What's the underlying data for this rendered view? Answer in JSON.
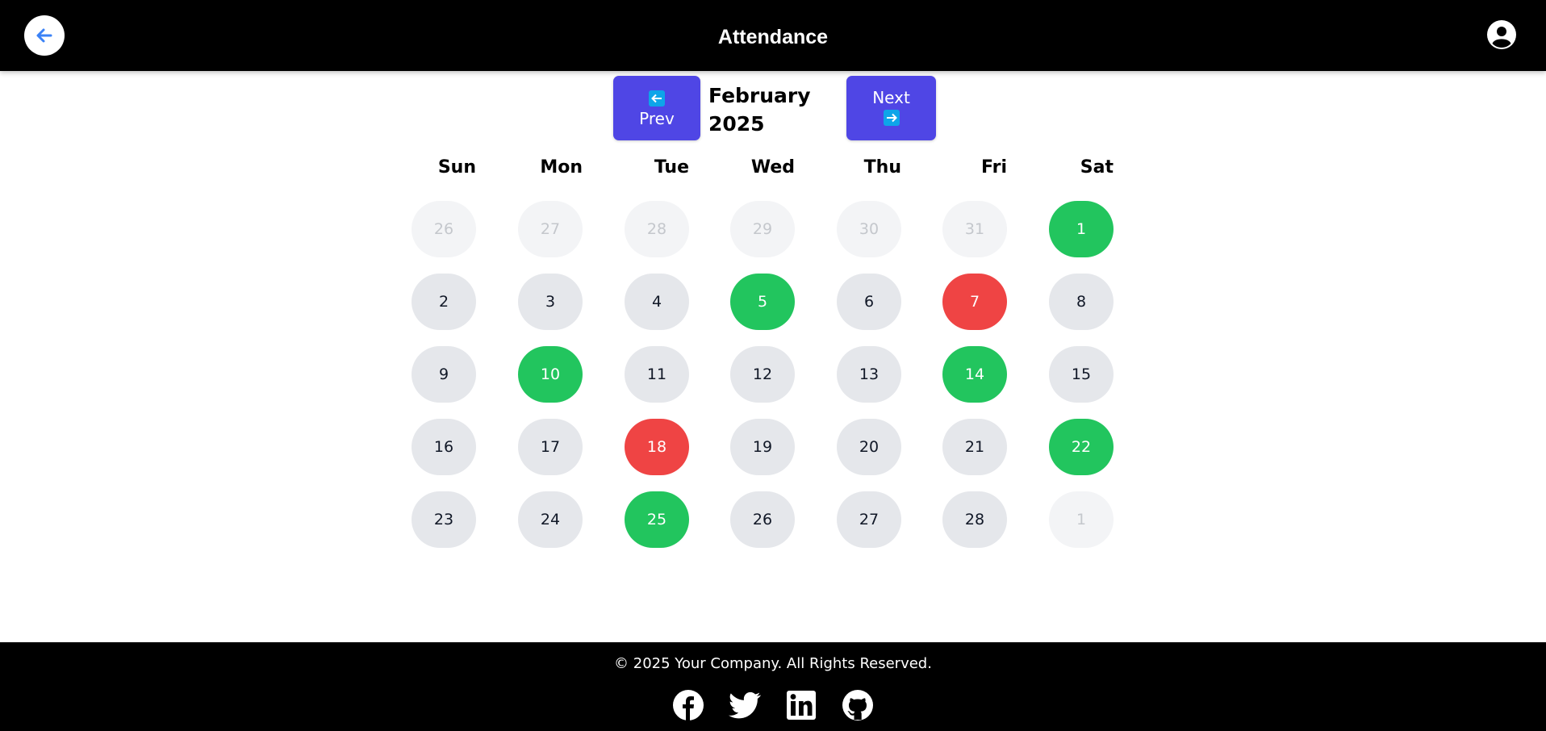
{
  "header": {
    "title": "Attendance",
    "back_icon": "arrow-left-icon",
    "profile_icon": "user-circle-icon"
  },
  "calendar": {
    "prev_label": "Prev",
    "next_label": "Next",
    "month": "February",
    "year": "2025",
    "weekdays": [
      "Sun",
      "Mon",
      "Tue",
      "Wed",
      "Thu",
      "Fri",
      "Sat"
    ],
    "weeks": [
      [
        {
          "d": "26",
          "s": "muted"
        },
        {
          "d": "27",
          "s": "muted"
        },
        {
          "d": "28",
          "s": "muted"
        },
        {
          "d": "29",
          "s": "muted"
        },
        {
          "d": "30",
          "s": "muted"
        },
        {
          "d": "31",
          "s": "muted"
        },
        {
          "d": "1",
          "s": "present"
        }
      ],
      [
        {
          "d": "2",
          "s": "none"
        },
        {
          "d": "3",
          "s": "none"
        },
        {
          "d": "4",
          "s": "none"
        },
        {
          "d": "5",
          "s": "present"
        },
        {
          "d": "6",
          "s": "none"
        },
        {
          "d": "7",
          "s": "absent"
        },
        {
          "d": "8",
          "s": "none"
        }
      ],
      [
        {
          "d": "9",
          "s": "none"
        },
        {
          "d": "10",
          "s": "present"
        },
        {
          "d": "11",
          "s": "none"
        },
        {
          "d": "12",
          "s": "none"
        },
        {
          "d": "13",
          "s": "none"
        },
        {
          "d": "14",
          "s": "present"
        },
        {
          "d": "15",
          "s": "none"
        }
      ],
      [
        {
          "d": "16",
          "s": "none"
        },
        {
          "d": "17",
          "s": "none"
        },
        {
          "d": "18",
          "s": "absent"
        },
        {
          "d": "19",
          "s": "none"
        },
        {
          "d": "20",
          "s": "none"
        },
        {
          "d": "21",
          "s": "none"
        },
        {
          "d": "22",
          "s": "present"
        }
      ],
      [
        {
          "d": "23",
          "s": "none"
        },
        {
          "d": "24",
          "s": "none"
        },
        {
          "d": "25",
          "s": "present"
        },
        {
          "d": "26",
          "s": "none"
        },
        {
          "d": "27",
          "s": "none"
        },
        {
          "d": "28",
          "s": "none"
        },
        {
          "d": "1",
          "s": "muted"
        }
      ]
    ]
  },
  "footer": {
    "copyright": "© 2025 Your Company. All Rights Reserved.",
    "socials": [
      "facebook-icon",
      "twitter-icon",
      "linkedin-icon",
      "github-icon"
    ]
  },
  "colors": {
    "header_bg": "#000000",
    "nav_button": "#4f46e5",
    "present": "#22c55e",
    "absent": "#ef4444",
    "default_day": "#e5e7eb",
    "muted_day": "#f3f4f6"
  }
}
